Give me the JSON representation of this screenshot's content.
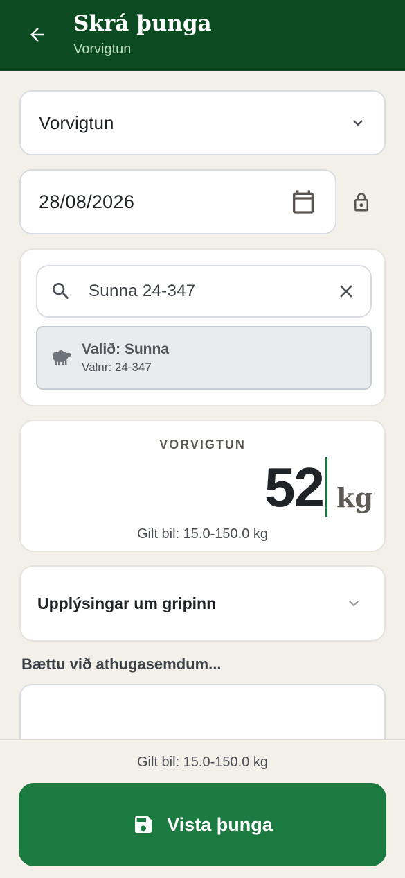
{
  "header": {
    "title": "Skrá þunga",
    "subtitle": "Vorvigtun"
  },
  "weighing_type": {
    "value": "Vorvigtun"
  },
  "date": {
    "value": "28/08/2026"
  },
  "search": {
    "value": "Sunna 24-347"
  },
  "selected": {
    "title": "Valið: Sunna",
    "subtitle": "Valnr: 24-347"
  },
  "weight": {
    "label": "VORVIGTUN",
    "value": "52",
    "unit": "kg",
    "range": "Gilt bil: 15.0-150.0 kg"
  },
  "info": {
    "label": "Upplýsingar um gripinn"
  },
  "notes": {
    "placeholder": "Bættu við athugasemdum..."
  },
  "footer": {
    "range": "Gilt bil: 15.0-150.0 kg",
    "save_label": "Vista þunga"
  },
  "colors": {
    "header_bg": "#0c4a22",
    "accent": "#1a7a3f",
    "page_bg": "#f3f0e9"
  }
}
